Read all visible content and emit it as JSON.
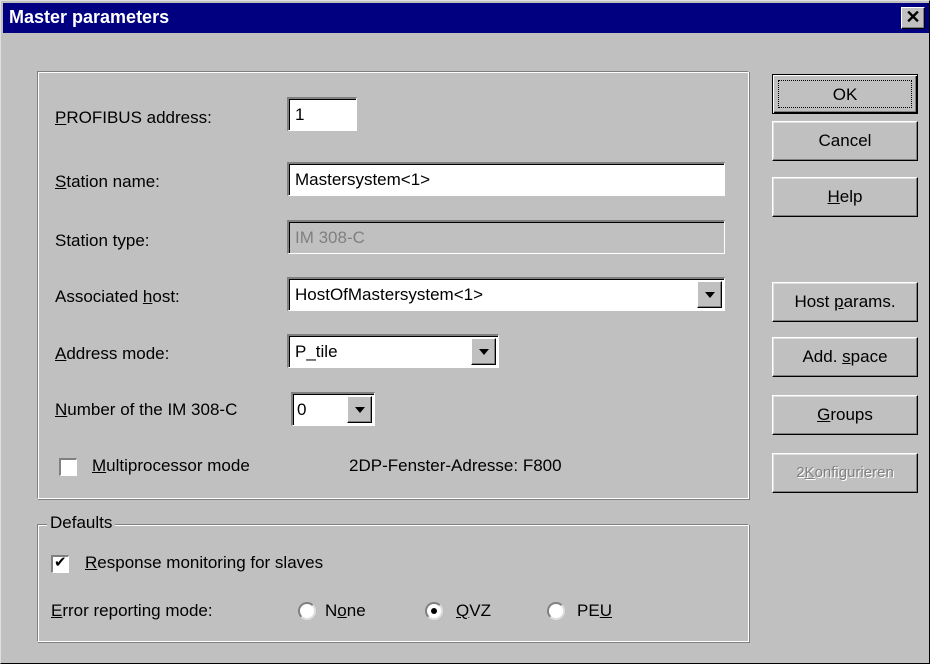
{
  "window": {
    "title": "Master parameters",
    "close_glyph": "✕"
  },
  "form": {
    "profibus_address": {
      "label_pre": "",
      "label_ul": "P",
      "label_post": "ROFIBUS address:",
      "value": "1"
    },
    "station_name": {
      "label_pre": "",
      "label_ul": "S",
      "label_post": "tation name:",
      "value": "Mastersystem<1>"
    },
    "station_type": {
      "label": "Station type:",
      "value": "IM 308-C"
    },
    "associated_host": {
      "label_pre": "Associated ",
      "label_ul": "h",
      "label_post": "ost:",
      "value": "HostOfMastersystem<1>"
    },
    "address_mode": {
      "label_pre": "",
      "label_ul": "A",
      "label_post": "ddress mode:",
      "value": "P_tile"
    },
    "im_number": {
      "label_pre": "",
      "label_ul": "N",
      "label_post": "umber of the IM 308-C",
      "value": "0"
    },
    "multiprocessor": {
      "label_pre": "",
      "label_ul": "M",
      "label_post": "ultiprocessor mode",
      "checked": false
    },
    "window_address": "2DP-Fenster-Adresse: F800"
  },
  "defaults": {
    "legend": "Defaults",
    "response_monitoring": {
      "label_pre": "",
      "label_ul": "R",
      "label_post": "esponse monitoring for slaves",
      "checked": true
    },
    "error_reporting": {
      "label_pre": "",
      "label_ul": "E",
      "label_post": "rror reporting mode:",
      "options": [
        {
          "pre": "N",
          "ul": "o",
          "post": "ne",
          "selected": false
        },
        {
          "pre": "",
          "ul": "Q",
          "post": "VZ",
          "selected": true
        },
        {
          "pre": "PE",
          "ul": "U",
          "post": "",
          "selected": false
        }
      ]
    }
  },
  "buttons": {
    "ok": "OK",
    "cancel": "Cancel",
    "help": {
      "pre": "",
      "ul": "H",
      "post": "elp"
    },
    "host_params": {
      "pre": "Host ",
      "ul": "p",
      "post": "arams."
    },
    "add_space": {
      "pre": "Add. ",
      "ul": "s",
      "post": "pace"
    },
    "groups": {
      "pre": "",
      "ul": "G",
      "post": "roups"
    },
    "configure": {
      "pre": "2",
      "ul": "K",
      "post": "onfigurieren"
    }
  }
}
